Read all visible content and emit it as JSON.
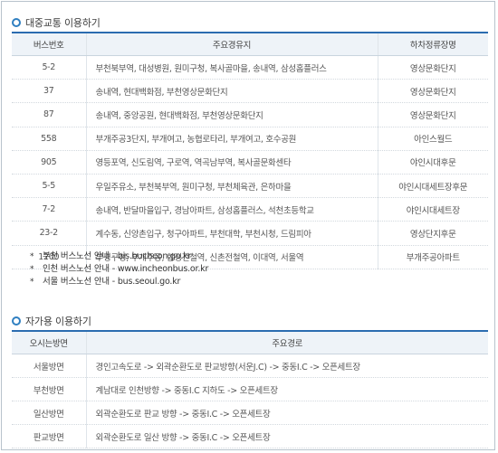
{
  "bus_section": {
    "title": "대중교통 이용하기",
    "headers": [
      "버스번호",
      "주요경유지",
      "하차정류장명"
    ],
    "rows": [
      {
        "bus": "5-2",
        "route": "부천북부역, 대성병원, 원미구청, 복사골마을, 송내역, 삼성홈플러스",
        "stop": "영상문화단지"
      },
      {
        "bus": "37",
        "route": "송내역, 현대백화점, 부천영상문화단지",
        "stop": "영상문화단지"
      },
      {
        "bus": "87",
        "route": "송내역, 중앙공원, 현대백화점, 부천영상문화단지",
        "stop": "영상문화단지"
      },
      {
        "bus": "558",
        "route": "부개주공3단지, 부개여고, 농협로타리, 부개여고, 호수공원",
        "stop": "아인스월드"
      },
      {
        "bus": "905",
        "route": "영등포역, 신도림역, 구로역, 역곡남부역, 복사골문화센타",
        "stop": "야인시대후문"
      },
      {
        "bus": "5-5",
        "route": "우일주유소, 부천북부역, 원미구청, 부천체육관, 은하마을",
        "stop": "야인시대세트장후문"
      },
      {
        "bus": "7-2",
        "route": "송내역, 반달마을입구, 경남아파트, 삼성홈플러스, 석천초등학교",
        "stop": "야인시대세트장"
      },
      {
        "bus": "23-2",
        "route": "계수동, 신앙촌입구, 청구아파트, 부천대학, 부천시청, 드림피아",
        "stop": "영상단지후문"
      },
      {
        "bus": "1200",
        "route": "부평구청, 부개주공, 합정전철역, 신촌전철역, 이대역, 서울역",
        "stop": "부개주공아파트"
      }
    ]
  },
  "links": [
    {
      "text": "부천 버스노선 안내 - bis.bucheon.go.kr"
    },
    {
      "text": "인천 버스노선 안내 - www.incheonbus.or.kr"
    },
    {
      "text": "서울 버스노선 안내 - bus.seoul.go.kr"
    }
  ],
  "car_section": {
    "title": "자가용 이용하기",
    "headers": [
      "오시는방면",
      "주요경로"
    ],
    "rows": [
      {
        "dir": "서울방면",
        "route": "경인고속도로 -> 외곽순환도로 판교방향(서운J.C) -> 중동I.C -> 오픈세트장"
      },
      {
        "dir": "부천방면",
        "route": "계남대로 인천방향 -> 중동I.C 지하도 -> 오픈세트장"
      },
      {
        "dir": "일산방면",
        "route": "외곽순환도로 판교 방향 -> 중동I.C -> 오픈세트장"
      },
      {
        "dir": "판교방면",
        "route": "외곽순환도로 일산 방향 -> 중동I.C -> 오픈세트장"
      }
    ]
  },
  "colors": {
    "accent": "#2b6cb0",
    "header_bg": "#eef3f8"
  }
}
